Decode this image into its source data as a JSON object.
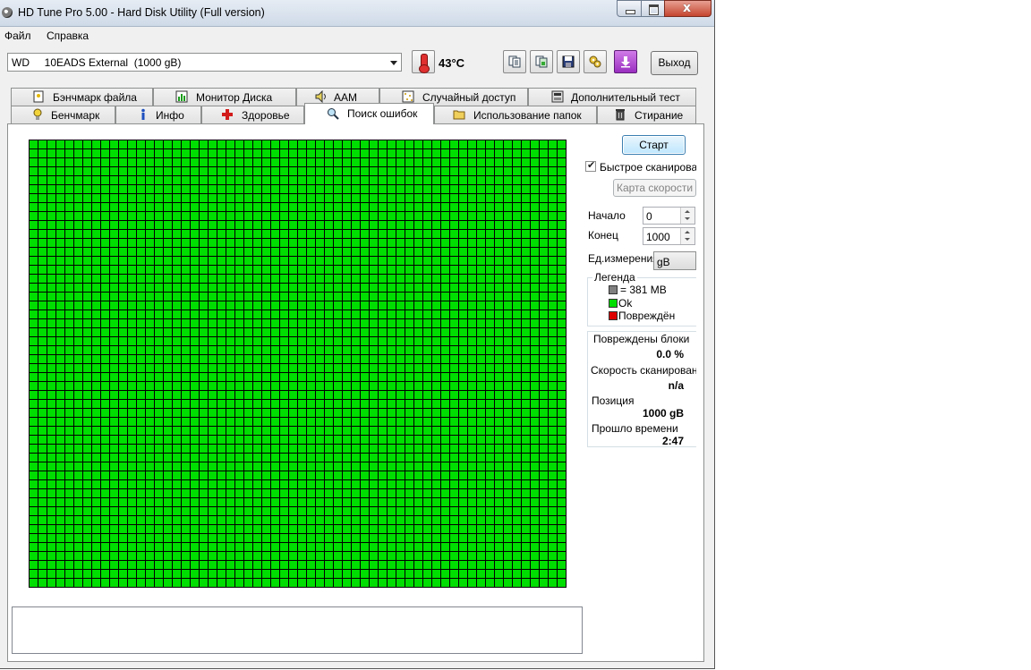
{
  "window": {
    "title": "HD Tune Pro 5.00 - Hard Disk Utility (Full  version)",
    "minimize_glyph": "",
    "close_glyph": "x"
  },
  "menu": {
    "file": "Файл",
    "help": "Справка"
  },
  "toolbar": {
    "drive": "WD     10EADS External  (1000 gB)",
    "temperature": "43°C",
    "exit_label": "Выход",
    "icons": [
      "copy-text-icon",
      "copy-screenshot-icon",
      "save-icon",
      "options-icon",
      "download-icon"
    ]
  },
  "tabs": {
    "row1": [
      {
        "label": "Бэнчмарк файла",
        "icon": "file-benchmark-icon"
      },
      {
        "label": "Монитор Диска",
        "icon": "disk-monitor-icon"
      },
      {
        "label": "AAM",
        "icon": "speaker-icon"
      },
      {
        "label": "Случайный доступ",
        "icon": "random-access-icon"
      },
      {
        "label": "Дополнительный  тест",
        "icon": "extra-tests-icon"
      }
    ],
    "row2": [
      {
        "label": "Бенчмарк",
        "icon": "benchmark-icon"
      },
      {
        "label": "Инфо",
        "icon": "info-icon"
      },
      {
        "label": "Здоровье",
        "icon": "health-icon"
      },
      {
        "label": "Поиск ошибок",
        "icon": "magnifier-icon",
        "active": true
      },
      {
        "label": "Использование папок",
        "icon": "folder-icon"
      },
      {
        "label": "Стирание",
        "icon": "trash-icon"
      }
    ]
  },
  "scan": {
    "start_label": "Старт",
    "quick_scan_label": "Быстрое сканирование",
    "quick_scan_checked": true,
    "speed_map_label": "Карта скорости",
    "start_field_label": "Начало",
    "start_value": "0",
    "end_field_label": "Конец",
    "end_value": "1000",
    "unit_label": "Ед.измерения",
    "unit_value": "gB",
    "grid_columns": 60,
    "grid_rows": 50,
    "grid_ok_fraction": 1.0
  },
  "legend": {
    "title": "Легенда",
    "items": [
      {
        "label": "= 381 MB",
        "color": "#808080"
      },
      {
        "label": "Ok",
        "color": "#00dd00"
      },
      {
        "label": "Повреждён",
        "color": "#dd0000"
      }
    ]
  },
  "stats": {
    "damaged_blocks_label": "Повреждены блоки",
    "damaged_blocks_value": "0.0 %",
    "scan_speed_label": "Скорость сканирования",
    "scan_speed_value": "n/a",
    "position_label": "Позиция",
    "position_value": "1000 gB",
    "elapsed_label": "Прошло времени",
    "elapsed_value": "2:47"
  }
}
